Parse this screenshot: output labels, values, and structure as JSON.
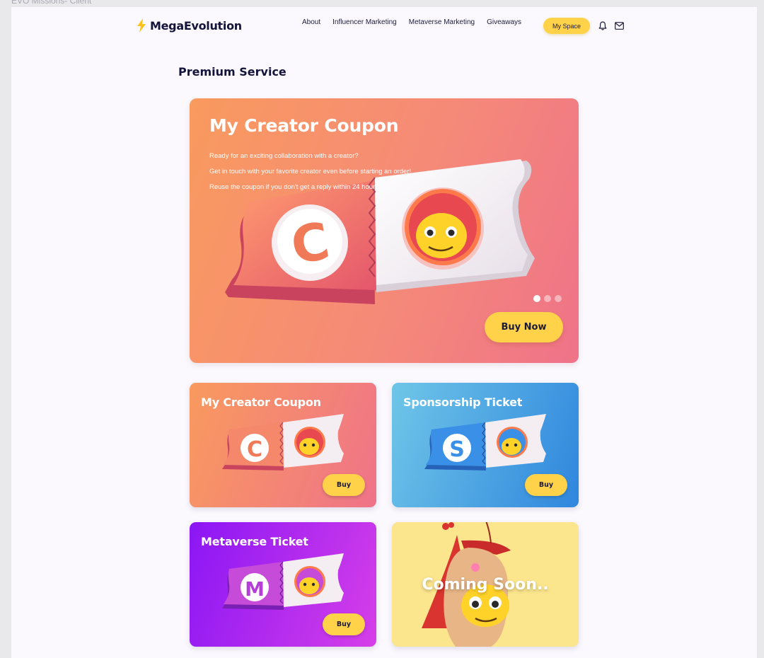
{
  "window_caption": "EVO Missions- Client",
  "brand": {
    "name": "MegaEvolution",
    "accent": "#ffd24a"
  },
  "nav": {
    "links": [
      "About",
      "Influencer Marketing",
      "Metaverse Marketing",
      "Giveaways"
    ],
    "myspace_label": "My Space",
    "icons": [
      "bell-icon",
      "mail-icon"
    ]
  },
  "page": {
    "title": "Premium Service"
  },
  "hero": {
    "title": "My Creator Coupon",
    "lines": [
      "Ready for an exciting collaboration with a creator?",
      "Get in touch with your favorite creator even before starting an order!",
      "Reuse the coupon if you don't get a reply within 24 hours!"
    ],
    "ticket_letter": "C",
    "carousel": {
      "slides": 3,
      "active": 1
    },
    "buy_label": "Buy Now"
  },
  "products": [
    {
      "title": "My Creator Coupon",
      "letter": "C",
      "buy_label": "Buy",
      "colors": [
        "#f99a5e",
        "#ef7389"
      ]
    },
    {
      "title": "Sponsorship Ticket",
      "letter": "S",
      "buy_label": "Buy",
      "colors": [
        "#6fc6e8",
        "#2f86dd"
      ]
    },
    {
      "title": "Metaverse Ticket",
      "letter": "M",
      "buy_label": "Buy",
      "colors": [
        "#8b16f5",
        "#d63fe8"
      ]
    },
    {
      "title": "Coming Soon..",
      "colors": [
        "#fbe58d"
      ]
    }
  ]
}
